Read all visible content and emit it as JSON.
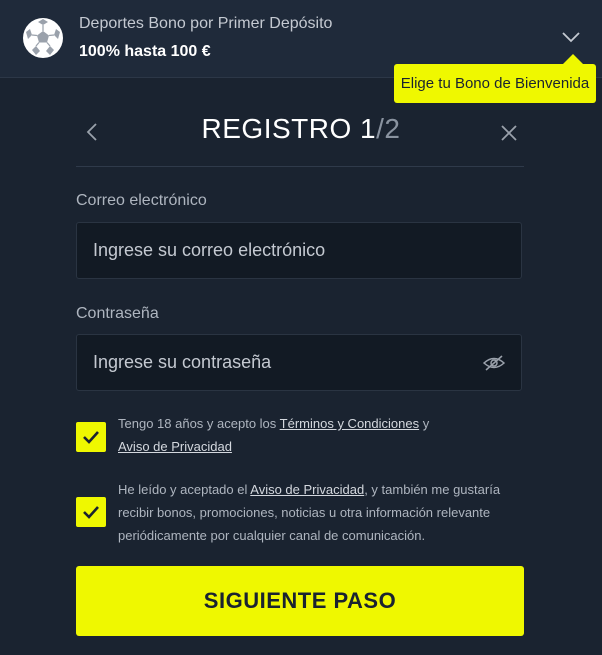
{
  "bonus": {
    "icon": "soccer-ball-icon",
    "title": "Deportes Bono por Primer Depósito",
    "amount": "100% hasta 100 €",
    "tooltip": "Elige tu Bono de Bienvenida"
  },
  "header": {
    "title_main": "REGISTRO 1",
    "title_total": "/2"
  },
  "form": {
    "email_label": "Correo electrónico",
    "email_placeholder": "Ingrese su correo electrónico",
    "email_value": "",
    "password_label": "Contraseña",
    "password_placeholder": "Ingrese su contraseña",
    "password_value": ""
  },
  "consents": {
    "terms": {
      "checked": true,
      "prefix": "Tengo 18 años y acepto los ",
      "link1": "Términos y Condiciones",
      "middle": " y ",
      "link2": "Aviso de Privacidad"
    },
    "marketing": {
      "checked": true,
      "prefix": "He leído y aceptado el ",
      "link": "Aviso de Privacidad",
      "suffix": ", y también me gustaría recibir bonos, promociones, noticias u otra información relevante periódicamente por cualquier canal de comunicación."
    }
  },
  "submit_label": "SIGUIENTE PASO",
  "colors": {
    "accent": "#eff800",
    "background": "#1a2330",
    "input_bg": "#121a24"
  }
}
